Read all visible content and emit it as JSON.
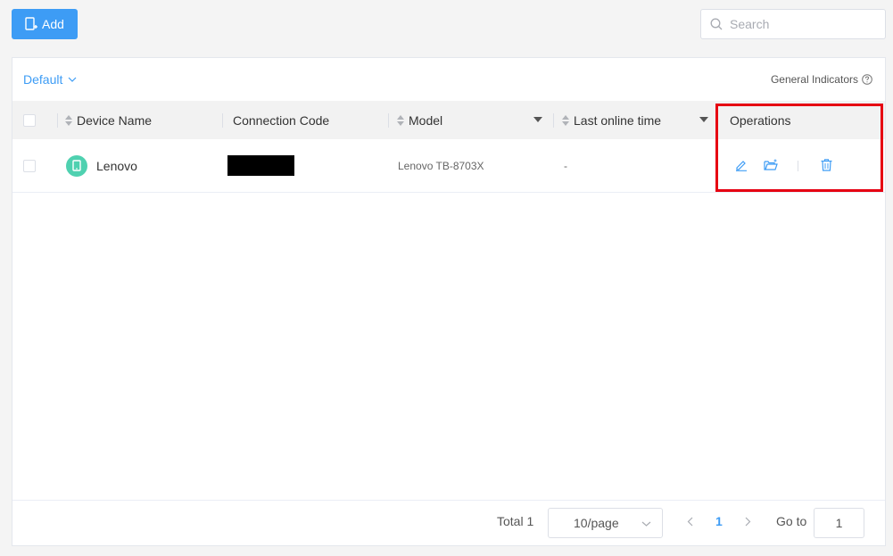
{
  "toolbar": {
    "add_label": "Add",
    "search_placeholder": "Search"
  },
  "panel": {
    "view_selector": "Default",
    "general_indicators": "General Indicators"
  },
  "table": {
    "columns": {
      "device_name": "Device Name",
      "connection_code": "Connection Code",
      "model": "Model",
      "last_online": "Last online time",
      "operations": "Operations"
    },
    "rows": [
      {
        "device_name": "Lenovo",
        "connection_code": "",
        "model": "Lenovo TB-8703X",
        "last_online": "-"
      }
    ]
  },
  "pagination": {
    "total": "Total 1",
    "page_size": "10/page",
    "current_page": "1",
    "goto_label": "Go to",
    "goto_value": "1"
  },
  "colors": {
    "primary": "#3d9cf5",
    "avatar": "#4fd1b0",
    "highlight": "#e60012"
  },
  "icons": {
    "add": "add-device-icon",
    "search": "search-icon",
    "dropdown": "chevron-down-icon",
    "help": "help-circle-icon",
    "edit": "edit-icon",
    "move": "folder-move-icon",
    "delete": "trash-icon"
  }
}
